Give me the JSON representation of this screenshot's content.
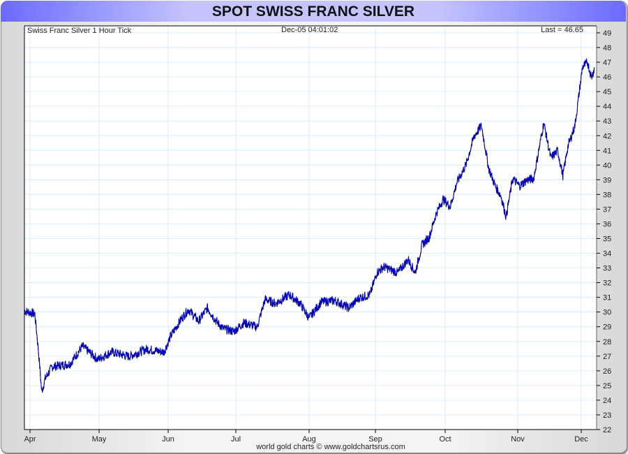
{
  "title": "SPOT SWISS FRANC SILVER",
  "footer": "world gold charts © www.goldchartsrus.com",
  "chart_data": {
    "type": "line",
    "title": "Swiss Franc Silver 1 Hour Tick",
    "timestamp": "Dec-05  04:01:02",
    "last_label": "Last = 46.65",
    "x_unit": "months since Apr 1",
    "x_ticks": [
      "Apr",
      "May",
      "Jun",
      "Jul",
      "Aug",
      "Sep",
      "Oct",
      "Nov",
      "Dec"
    ],
    "y_ticks": [
      22,
      23,
      24,
      25,
      26,
      27,
      28,
      29,
      30,
      31,
      32,
      33,
      34,
      35,
      36,
      37,
      38,
      39,
      40,
      41,
      42,
      43,
      44,
      45,
      46,
      47,
      48,
      49
    ],
    "ylim": [
      22,
      49.4
    ],
    "grid": true,
    "line_color": "#0000cc",
    "series": [
      {
        "name": "Swiss Franc Silver",
        "x": [
          -0.08,
          0.07,
          0.12,
          0.17,
          0.22,
          0.32,
          0.58,
          0.76,
          0.98,
          1.18,
          1.43,
          1.69,
          1.94,
          2.04,
          2.2,
          2.3,
          2.45,
          2.58,
          2.71,
          2.81,
          2.97,
          3.11,
          3.29,
          3.4,
          3.54,
          3.73,
          3.88,
          4.0,
          4.18,
          4.39,
          4.6,
          4.76,
          4.92,
          5.02,
          5.12,
          5.32,
          5.47,
          5.57,
          5.67,
          5.77,
          5.87,
          5.97,
          6.07,
          6.16,
          6.29,
          6.4,
          6.5,
          6.6,
          6.69,
          6.77,
          6.84,
          6.93,
          7.03,
          7.14,
          7.25,
          7.33,
          7.41,
          7.52,
          7.63,
          7.71,
          7.79,
          7.9,
          8.02,
          8.1,
          8.16,
          8.21
        ],
        "y": [
          30.1,
          29.9,
          27.5,
          24.6,
          25.5,
          26.3,
          26.5,
          27.7,
          26.8,
          27.3,
          27.0,
          27.5,
          27.3,
          28.4,
          29.6,
          30.2,
          29.4,
          30.3,
          29.4,
          28.9,
          28.7,
          29.3,
          29.0,
          30.9,
          30.6,
          31.2,
          30.6,
          29.6,
          30.7,
          30.8,
          30.3,
          31.0,
          31.2,
          32.7,
          33.1,
          32.7,
          33.6,
          32.7,
          34.6,
          35.1,
          36.7,
          37.7,
          37.2,
          38.8,
          40.1,
          42.0,
          42.7,
          39.8,
          38.6,
          37.9,
          36.5,
          39.1,
          38.6,
          39.0,
          39.1,
          41.0,
          42.9,
          40.5,
          41.0,
          39.3,
          41.3,
          42.7,
          46.7,
          47.0,
          46.0,
          46.65
        ]
      }
    ]
  }
}
